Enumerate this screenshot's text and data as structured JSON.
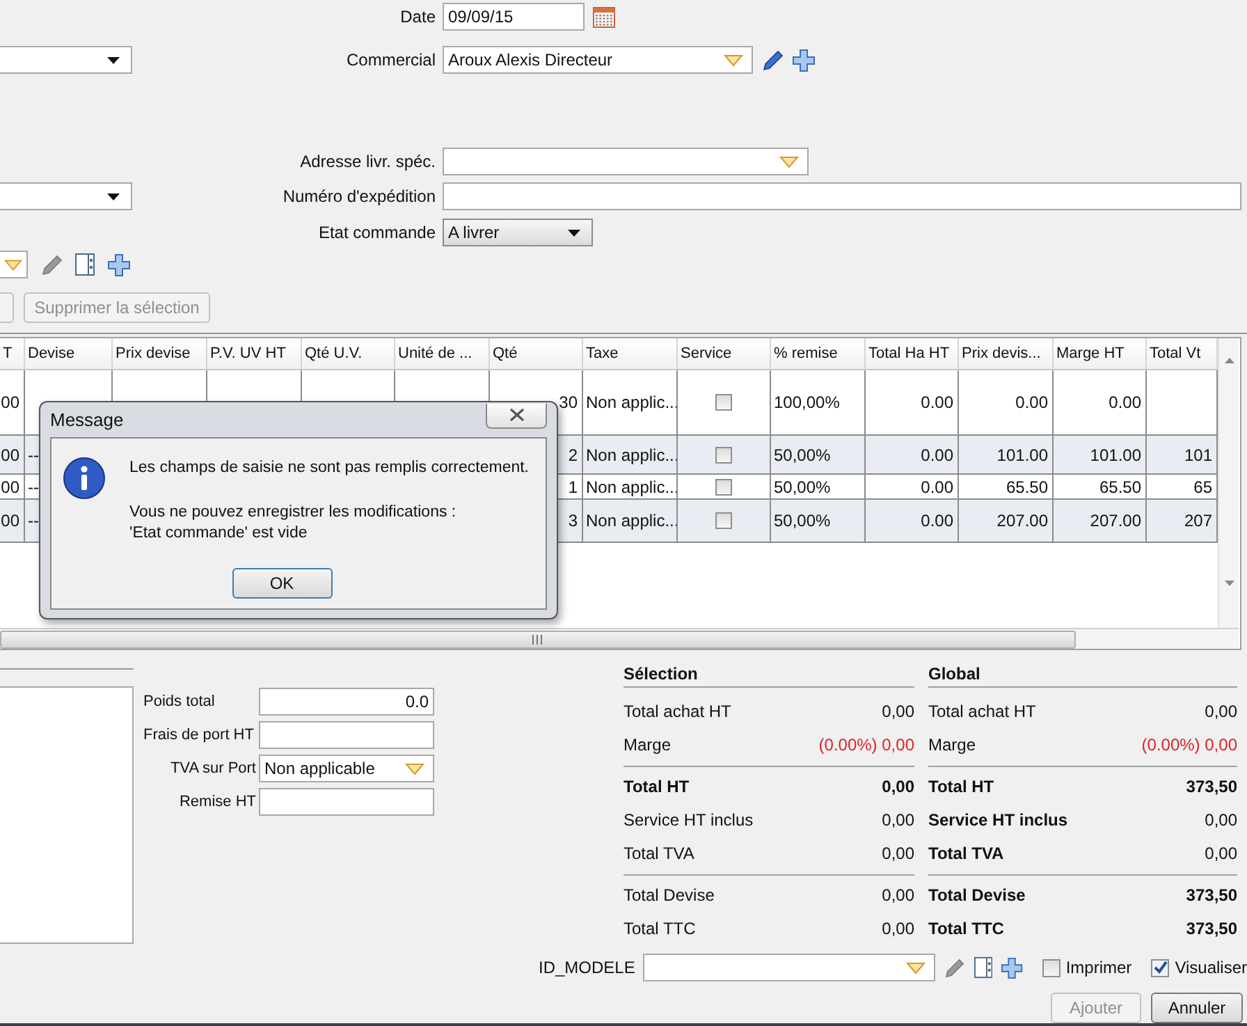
{
  "order_form": {
    "rows": [
      {
        "label": "Date",
        "value": "09/09/15",
        "kind": "date",
        "left_combo": false
      },
      {
        "label": "Commercial",
        "value": "Aroux Alexis Directeur",
        "kind": "lookup",
        "left_combo": true
      },
      {
        "label": "Adresse livr. spéc.",
        "kind": "lookup",
        "left_combo": false
      },
      {
        "label": "Numéro d'expédition",
        "kind": "text",
        "left_combo": true
      },
      {
        "label": "Etat commande",
        "value": "A livrer",
        "kind": "select",
        "left_combo": false
      }
    ],
    "buttons": [
      {
        "label": "Supprimer la sélection",
        "disabled": true
      }
    ]
  },
  "table": {
    "columns": [
      {
        "label": "T",
        "kind": "text"
      },
      {
        "label": "Devise",
        "kind": "text"
      },
      {
        "label": "Prix devise",
        "kind": "text"
      },
      {
        "label": "P.V. UV HT",
        "kind": "text"
      },
      {
        "label": "Qté U.V.",
        "kind": "text"
      },
      {
        "label": "Unité de ...",
        "kind": "text"
      },
      {
        "label": "Qté",
        "kind": "text"
      },
      {
        "label": "Taxe",
        "kind": "text"
      },
      {
        "label": "Service",
        "kind": "checkbox"
      },
      {
        "label": "% remise",
        "kind": "text"
      },
      {
        "label": "Total Ha HT",
        "kind": "text"
      },
      {
        "label": "Prix devis...",
        "kind": "text"
      },
      {
        "label": "Marge HT",
        "kind": "text"
      },
      {
        "label": "Total Vt",
        "kind": "text"
      }
    ],
    "rows": [
      [
        "00",
        null,
        null,
        null,
        null,
        null,
        "30",
        "Non applic...",
        false,
        "100,00%",
        "0.00",
        "0.00",
        "0.00",
        null
      ],
      [
        "00",
        "--",
        null,
        null,
        null,
        null,
        "2",
        "Non applic...",
        false,
        "50,00%",
        "0.00",
        "101.00",
        "101.00",
        "101"
      ],
      [
        "00",
        "--",
        null,
        null,
        null,
        null,
        "1",
        "Non applic...",
        false,
        "50,00%",
        "0.00",
        "65.50",
        "65.50",
        "65"
      ],
      [
        "00",
        "--",
        null,
        null,
        null,
        null,
        "3",
        "Non applic...",
        false,
        "50,00%",
        "0.00",
        "207.00",
        "207.00",
        "207"
      ]
    ]
  },
  "dialog": {
    "title": "Message",
    "message": "Les champs de saisie ne sont pas remplis correctement.",
    "details": [
      "Vous ne pouvez enregistrer les modifications :",
      "'Etat commande' est vide"
    ],
    "button": "OK"
  },
  "shipping": [
    {
      "label": "Poids total",
      "value": "0.0",
      "kind": "number"
    },
    {
      "label": "Frais de port HT",
      "kind": "text"
    },
    {
      "label": "TVA sur Port",
      "value": "Non applicable",
      "kind": "combo"
    },
    {
      "label": "Remise HT",
      "kind": "text"
    }
  ],
  "summary": [
    {
      "title": "Sélection",
      "groups": [
        [
          {
            "label": "Total achat HT",
            "value": "0,00",
            "bold_label": false,
            "bold_value": false,
            "alert": false
          },
          {
            "label": "Marge",
            "value": "(0.00%) 0,00",
            "bold_label": false,
            "bold_value": false,
            "alert": true
          }
        ],
        [
          {
            "label": "Total HT",
            "value": "0,00",
            "bold_label": true,
            "bold_value": true,
            "alert": false
          },
          {
            "label": "Service HT inclus",
            "value": "0,00",
            "bold_label": false,
            "bold_value": false,
            "alert": false
          },
          {
            "label": "Total TVA",
            "value": "0,00",
            "bold_label": false,
            "bold_value": false,
            "alert": false
          }
        ],
        [
          {
            "label": "Total Devise",
            "value": "0,00",
            "bold_label": false,
            "bold_value": false,
            "alert": false
          },
          {
            "label": "Total TTC",
            "value": "0,00",
            "bold_label": false,
            "bold_value": false,
            "alert": false
          }
        ]
      ]
    },
    {
      "title": "Global",
      "groups": [
        [
          {
            "label": "Total achat HT",
            "value": "0,00",
            "bold_label": false,
            "bold_value": false,
            "alert": false
          },
          {
            "label": "Marge",
            "value": "(0.00%) 0,00",
            "bold_label": false,
            "bold_value": false,
            "alert": true
          }
        ],
        [
          {
            "label": "Total HT",
            "value": "373,50",
            "bold_label": true,
            "bold_value": true,
            "alert": false
          },
          {
            "label": "Service HT inclus",
            "value": "0,00",
            "bold_label": true,
            "bold_value": false,
            "alert": false
          },
          {
            "label": "Total TVA",
            "value": "0,00",
            "bold_label": true,
            "bold_value": false,
            "alert": false
          }
        ],
        [
          {
            "label": "Total Devise",
            "value": "373,50",
            "bold_label": true,
            "bold_value": true,
            "alert": false
          },
          {
            "label": "Total TTC",
            "value": "373,50",
            "bold_label": true,
            "bold_value": true,
            "alert": false
          }
        ]
      ]
    }
  ],
  "footer": {
    "label": "ID_MODELE",
    "checkboxes": [
      {
        "label": "Imprimer",
        "checked": false
      },
      {
        "label": "Visualiser",
        "checked": true
      }
    ],
    "buttons": [
      {
        "label": "Ajouter",
        "disabled": true
      },
      {
        "label": "Annuler",
        "disabled": false
      }
    ]
  }
}
